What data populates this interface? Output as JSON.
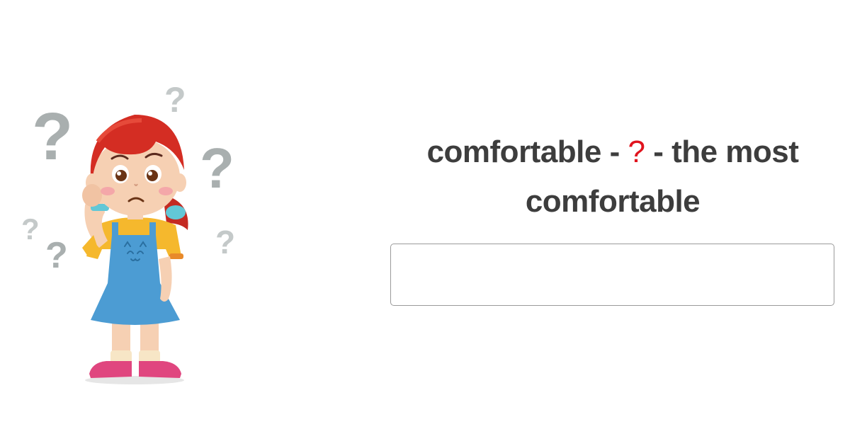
{
  "question": {
    "before": "comfortable - ",
    "blank": "?",
    "after": " - the most comfortable"
  },
  "answer_input": {
    "value": "",
    "placeholder": ""
  },
  "illustration": {
    "icon": "confused-girl-illustration",
    "colors": {
      "question_marks": "#a9afaf",
      "hair": "#d42d23",
      "shirt": "#f5b82d",
      "dress": "#4c9cd3",
      "shoes": "#e0467f"
    }
  },
  "colors": {
    "text": "#3d3d3d",
    "blank": "#e0141e",
    "input_border": "#9a9a9a"
  }
}
